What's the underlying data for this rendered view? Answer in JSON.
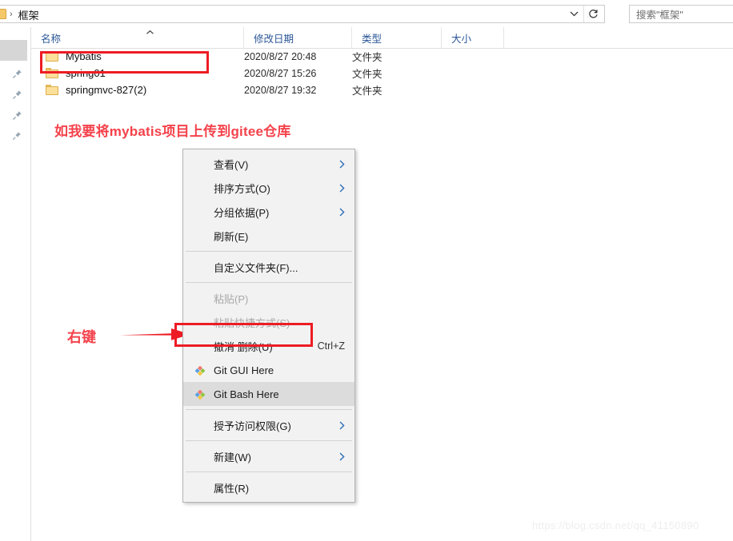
{
  "window": {
    "address": {
      "breadcrumb_separator": "›",
      "current_folder": "框架",
      "dropdown_icon": "chevron-down-icon",
      "refresh_icon": "refresh-icon"
    },
    "search": {
      "placeholder": "搜索\"框架\""
    }
  },
  "nav_pane": {
    "pin_icon": "📌"
  },
  "columns": [
    {
      "label": "名称",
      "sort_indicator": "^"
    },
    {
      "label": "修改日期",
      "sort_indicator": ""
    },
    {
      "label": "类型",
      "sort_indicator": ""
    },
    {
      "label": "大小",
      "sort_indicator": ""
    }
  ],
  "files": [
    {
      "name": "Mybatis",
      "date": "2020/8/27 20:48",
      "type": "文件夹",
      "size": "",
      "icon": "folder-icon"
    },
    {
      "name": "spring01",
      "date": "2020/8/27 15:26",
      "type": "文件夹",
      "size": "",
      "icon": "folder-icon"
    },
    {
      "name": "springmvc-827(2)",
      "date": "2020/8/27 19:32",
      "type": "文件夹",
      "size": "",
      "icon": "folder-icon"
    }
  ],
  "context_menu": {
    "items": [
      {
        "label": "查看(V)",
        "kind": "submenu",
        "accel": "",
        "icon": "",
        "state": "normal"
      },
      {
        "label": "排序方式(O)",
        "kind": "submenu",
        "accel": "",
        "icon": "",
        "state": "normal"
      },
      {
        "label": "分组依据(P)",
        "kind": "submenu",
        "accel": "",
        "icon": "",
        "state": "normal"
      },
      {
        "label": "刷新(E)",
        "kind": "item",
        "accel": "",
        "icon": "",
        "state": "normal"
      },
      {
        "label": "",
        "kind": "separator",
        "accel": "",
        "icon": "",
        "state": "normal"
      },
      {
        "label": "自定义文件夹(F)...",
        "kind": "item",
        "accel": "",
        "icon": "",
        "state": "normal"
      },
      {
        "label": "",
        "kind": "separator",
        "accel": "",
        "icon": "",
        "state": "normal"
      },
      {
        "label": "粘贴(P)",
        "kind": "item",
        "accel": "",
        "icon": "",
        "state": "disabled"
      },
      {
        "label": "粘贴快捷方式(S)",
        "kind": "item",
        "accel": "",
        "icon": "",
        "state": "disabled"
      },
      {
        "label": "撤消 删除(U)",
        "kind": "item",
        "accel": "Ctrl+Z",
        "icon": "",
        "state": "normal"
      },
      {
        "label": "Git GUI Here",
        "kind": "item",
        "accel": "",
        "icon": "git-icon",
        "state": "normal"
      },
      {
        "label": "Git Bash Here",
        "kind": "item",
        "accel": "",
        "icon": "git-icon",
        "state": "hovered"
      },
      {
        "label": "",
        "kind": "separator",
        "accel": "",
        "icon": "",
        "state": "normal"
      },
      {
        "label": "授予访问权限(G)",
        "kind": "submenu",
        "accel": "",
        "icon": "",
        "state": "normal"
      },
      {
        "label": "",
        "kind": "separator",
        "accel": "",
        "icon": "",
        "state": "normal"
      },
      {
        "label": "新建(W)",
        "kind": "submenu",
        "accel": "",
        "icon": "",
        "state": "normal"
      },
      {
        "label": "",
        "kind": "separator",
        "accel": "",
        "icon": "",
        "state": "normal"
      },
      {
        "label": "属性(R)",
        "kind": "item",
        "accel": "",
        "icon": "",
        "state": "normal"
      }
    ],
    "submenu_arrow_glyph": "❯"
  },
  "annotations": {
    "note_text": "如我要将mybatis项目上传到gitee仓库",
    "rightclick_label": "右键",
    "highlight_color": "#ed1c24",
    "text_color": "#f4424b"
  },
  "watermark": {
    "text": "https://blog.csdn.net/qq_41150890"
  }
}
